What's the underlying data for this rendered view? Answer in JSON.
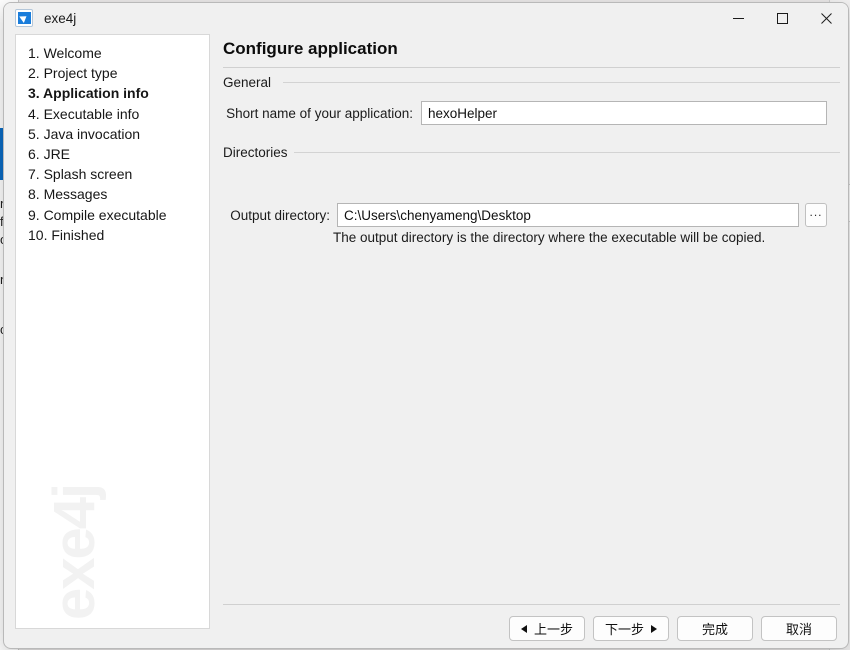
{
  "background": {
    "left_fragments": [
      "nl",
      "fu",
      "or",
      "n",
      "cu"
    ],
    "accent_color": "#0b6cc4"
  },
  "window": {
    "title": "exe4j",
    "icon": "exe4j-app-icon",
    "controls": {
      "minimize": "minimize-icon",
      "maximize": "maximize-icon",
      "close": "close-icon"
    }
  },
  "sidebar": {
    "steps": [
      {
        "label": "1. Welcome",
        "active": false
      },
      {
        "label": "2. Project type",
        "active": false
      },
      {
        "label": "3. Application info",
        "active": true
      },
      {
        "label": "4. Executable info",
        "active": false
      },
      {
        "label": "5. Java invocation",
        "active": false
      },
      {
        "label": "6. JRE",
        "active": false
      },
      {
        "label": "7. Splash screen",
        "active": false
      },
      {
        "label": "8. Messages",
        "active": false
      },
      {
        "label": "9. Compile executable",
        "active": false
      },
      {
        "label": "10. Finished",
        "active": false
      }
    ],
    "watermark": "exe4j"
  },
  "content": {
    "page_title": "Configure application",
    "general": {
      "group_label": "General",
      "short_name_label": "Short name of your application:",
      "short_name_value": "hexoHelper",
      "short_name_placeholder": ""
    },
    "directories": {
      "group_label": "Directories",
      "output_directory_label": "Output directory:",
      "output_directory_value": "C:\\Users\\chenyameng\\Desktop",
      "output_directory_placeholder": "",
      "browse_label": "...",
      "hint": "The output directory is the directory where the executable will be copied."
    }
  },
  "footer": {
    "back_label": "上一步",
    "next_label": "下一步",
    "finish_label": "完成",
    "cancel_label": "取消"
  }
}
